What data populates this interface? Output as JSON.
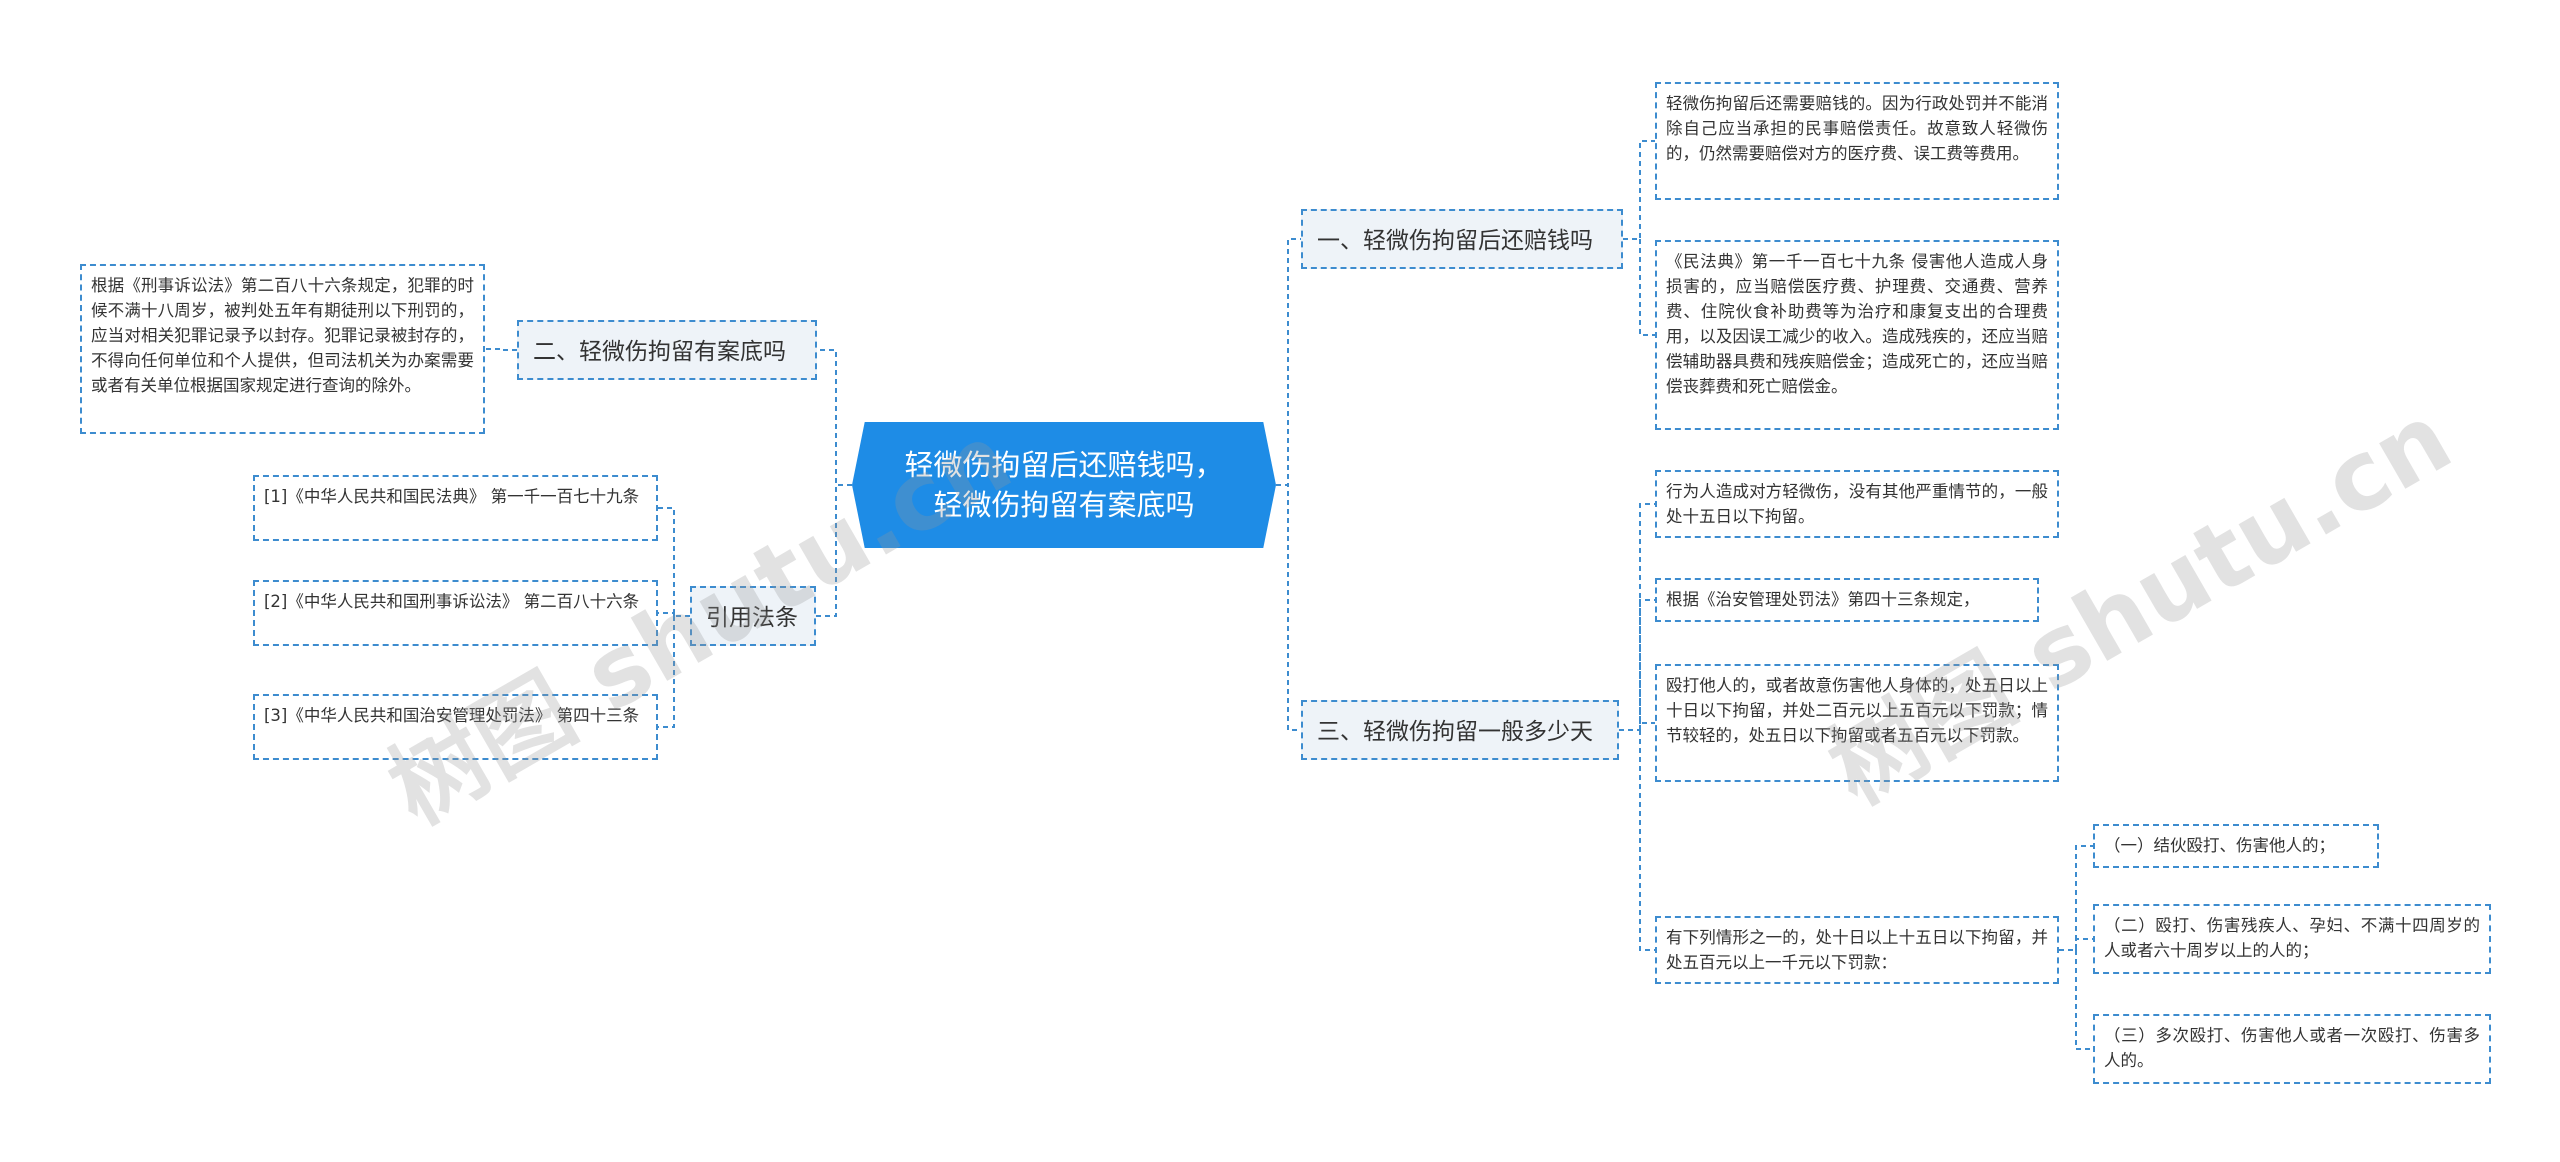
{
  "root": {
    "label": "轻微伤拘留后还赔钱吗，\n轻微伤拘留有案底吗"
  },
  "branches": {
    "b1": {
      "label": "一、轻微伤拘留后还赔钱吗",
      "items": [
        "轻微伤拘留后还需要赔钱的。因为行政处罚并不能消除自己应当承担的民事赔偿责任。故意致人轻微伤的，仍然需要赔偿对方的医疗费、误工费等费用。",
        "《民法典》第一千一百七十九条 侵害他人造成人身损害的，应当赔偿医疗费、护理费、交通费、营养费、住院伙食补助费等为治疗和康复支出的合理费用，以及因误工减少的收入。造成残疾的，还应当赔偿辅助器具费和残疾赔偿金；造成死亡的，还应当赔偿丧葬费和死亡赔偿金。"
      ]
    },
    "b2": {
      "label": "二、轻微伤拘留有案底吗",
      "items": [
        "根据《刑事诉讼法》第二百八十六条规定，犯罪的时候不满十八周岁，被判处五年有期徒刑以下刑罚的，应当对相关犯罪记录予以封存。犯罪记录被封存的，不得向任何单位和个人提供，但司法机关为办案需要或者有关单位根据国家规定进行查询的除外。"
      ]
    },
    "b3": {
      "label": "三、轻微伤拘留一般多少天",
      "items": [
        "行为人造成对方轻微伤，没有其他严重情节的，一般处十五日以下拘留。",
        "根据《治安管理处罚法》第四十三条规定，",
        "殴打他人的，或者故意伤害他人身体的，处五日以上十日以下拘留，并处二百元以上五百元以下罚款；情节较轻的，处五日以下拘留或者五百元以下罚款。",
        "有下列情形之一的，处十日以上十五日以下拘留，并处五百元以上一千元以下罚款："
      ],
      "sub_items": [
        "（一）结伙殴打、伤害他人的；",
        "（二）殴打、伤害残疾人、孕妇、不满十四周岁的人或者六十周岁以上的人的；",
        "（三）多次殴打、伤害他人或者一次殴打、伤害多人的。"
      ]
    },
    "b4": {
      "label": "引用法条",
      "items": [
        "[1]《中华人民共和国民法典》 第一千一百七十九条",
        "[2]《中华人民共和国刑事诉讼法》 第二百八十六条",
        "[3]《中华人民共和国治安管理处罚法》 第四十三条"
      ]
    }
  },
  "watermarks": [
    "树图 shutu.cn",
    "树图 shutu.cn"
  ],
  "colors": {
    "root_fill": "#1e8ce6",
    "node_border": "#3d8ccf",
    "branch_fill": "#eef3f8",
    "connector": "#3d8ccf"
  }
}
